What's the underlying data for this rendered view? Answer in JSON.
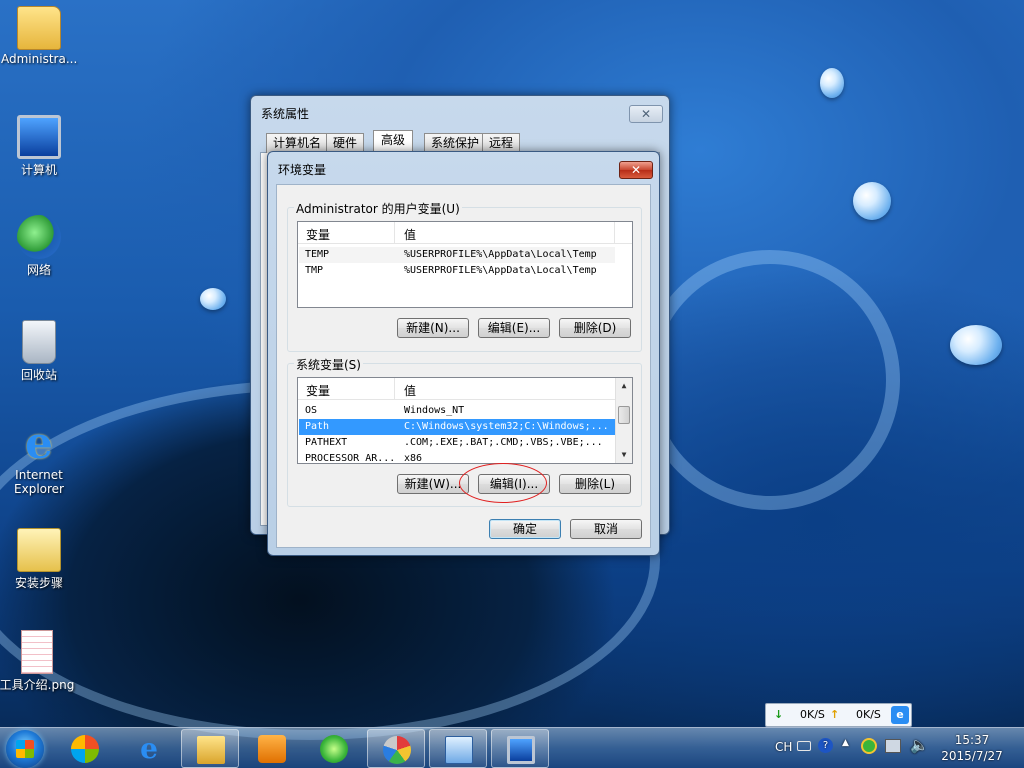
{
  "desktop": {
    "icons": [
      {
        "label": "Administra..."
      },
      {
        "label": "计算机"
      },
      {
        "label": "网络"
      },
      {
        "label": "回收站"
      },
      {
        "label": "Internet\nExplorer",
        "line1": "Internet",
        "line2": "Explorer"
      },
      {
        "label": "安装步骤"
      },
      {
        "label": "工具介绍.png"
      }
    ]
  },
  "sysprops": {
    "title": "系统属性",
    "close": "✕",
    "tabs": [
      "计算机名",
      "硬件",
      "高级",
      "系统保护",
      "远程"
    ],
    "selected_tab": "高级"
  },
  "envdlg": {
    "title": "环境变量",
    "close": "✕",
    "user_group_label": "Administrator 的用户变量(U)",
    "system_group_label": "系统变量(S)",
    "col_var": "变量",
    "col_val": "值",
    "user_vars": [
      {
        "name": "TEMP",
        "value": "%USERPROFILE%\\AppData\\Local\\Temp"
      },
      {
        "name": "TMP",
        "value": "%USERPROFILE%\\AppData\\Local\\Temp"
      }
    ],
    "system_vars": [
      {
        "name": "OS",
        "value": "Windows_NT"
      },
      {
        "name": "Path",
        "value": "C:\\Windows\\system32;C:\\Windows;..."
      },
      {
        "name": "PATHEXT",
        "value": ".COM;.EXE;.BAT;.CMD;.VBS;.VBE;..."
      },
      {
        "name": "PROCESSOR_AR...",
        "value": "x86"
      }
    ],
    "selected_system_var": "Path",
    "user_buttons": {
      "new": "新建(N)...",
      "edit": "编辑(E)...",
      "delete": "删除(D)"
    },
    "system_buttons": {
      "new": "新建(W)...",
      "edit": "编辑(I)...",
      "delete": "删除(L)"
    },
    "ok": "确定",
    "cancel": "取消"
  },
  "netspeed": {
    "down_arrow": "↓",
    "down": "0K/S",
    "up_arrow": "↑",
    "up": "0K/S"
  },
  "taskbar": {
    "apps": [
      "windows-media-player",
      "ie",
      "explorer",
      "360",
      "paint",
      "control-panel",
      "system"
    ],
    "lang": "CH",
    "time": "15:37",
    "date": "2015/7/27"
  }
}
